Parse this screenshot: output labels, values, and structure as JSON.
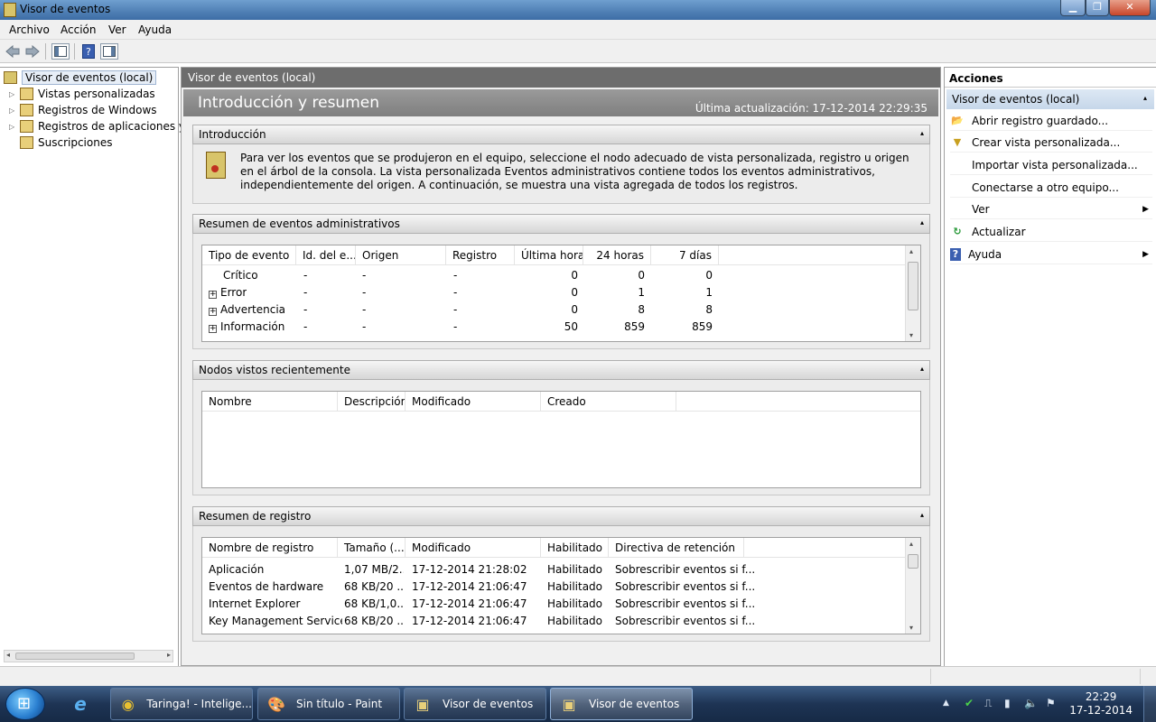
{
  "window": {
    "title": "Visor de eventos",
    "controls": {
      "minimize": "▁",
      "maximize": "❐",
      "close": "✕"
    }
  },
  "menu": [
    "Archivo",
    "Acción",
    "Ver",
    "Ayuda"
  ],
  "toolbar": {
    "back_icon": "back-arrow-icon",
    "forward_icon": "forward-arrow-icon",
    "show_hide_icon": "console-tree-icon",
    "help_icon": "help-icon",
    "actions_pane_icon": "action-pane-icon"
  },
  "tree": {
    "items": [
      {
        "label": "Visor de eventos (local)",
        "expander": "",
        "selected": true
      },
      {
        "label": "Vistas personalizadas",
        "expander": "▷"
      },
      {
        "label": "Registros de Windows",
        "expander": "▷"
      },
      {
        "label": "Registros de aplicaciones y s",
        "expander": "▷"
      },
      {
        "label": "Suscripciones",
        "expander": ""
      }
    ],
    "scroll_left": "◂",
    "scroll_right": "▸"
  },
  "center": {
    "header": "Visor de eventos (local)",
    "intro_title": "Introducción y resumen",
    "last_update": "Última actualización: 17-12-2014 22:29:35",
    "collapse_glyph": "▴",
    "sections": {
      "intro": {
        "title": "Introducción",
        "text": "Para ver los eventos que se produjeron en el equipo, seleccione el nodo adecuado de vista personalizada, registro u origen en el árbol de la consola. La vista personalizada Eventos administrativos contiene todos los eventos administrativos, independientemente del origen. A continuación, se muestra una vista agregada de todos los registros."
      },
      "admin_summary": {
        "title": "Resumen de eventos administrativos",
        "columns": [
          "Tipo de evento",
          "Id. del e...",
          "Origen",
          "Registro",
          "Última hora",
          "24 horas",
          "7 días"
        ],
        "rows": [
          {
            "expand": "",
            "type": "Crítico",
            "id": "-",
            "source": "-",
            "log": "-",
            "last_hour": "0",
            "h24": "0",
            "d7": "0"
          },
          {
            "expand": "+",
            "type": "Error",
            "id": "-",
            "source": "-",
            "log": "-",
            "last_hour": "0",
            "h24": "1",
            "d7": "1"
          },
          {
            "expand": "+",
            "type": "Advertencia",
            "id": "-",
            "source": "-",
            "log": "-",
            "last_hour": "0",
            "h24": "8",
            "d7": "8"
          },
          {
            "expand": "+",
            "type": "Información",
            "id": "-",
            "source": "-",
            "log": "-",
            "last_hour": "50",
            "h24": "859",
            "d7": "859"
          }
        ]
      },
      "recent_nodes": {
        "title": "Nodos vistos recientemente",
        "columns": [
          "Nombre",
          "Descripción",
          "Modificado",
          "Creado"
        ]
      },
      "log_summary": {
        "title": "Resumen de registro",
        "columns": [
          "Nombre de registro",
          "Tamaño (...",
          "Modificado",
          "Habilitado",
          "Directiva de retención"
        ],
        "rows": [
          {
            "name": "Aplicación",
            "size": "1,07 MB/2...",
            "modified": "17-12-2014 21:28:02",
            "enabled": "Habilitado",
            "policy": "Sobrescribir eventos si f..."
          },
          {
            "name": "Eventos de hardware",
            "size": "68 KB/20 ...",
            "modified": "17-12-2014 21:06:47",
            "enabled": "Habilitado",
            "policy": "Sobrescribir eventos si f..."
          },
          {
            "name": "Internet Explorer",
            "size": "68 KB/1,0...",
            "modified": "17-12-2014 21:06:47",
            "enabled": "Habilitado",
            "policy": "Sobrescribir eventos si f..."
          },
          {
            "name": "Key Management Service",
            "size": "68 KB/20 ...",
            "modified": "17-12-2014 21:06:47",
            "enabled": "Habilitado",
            "policy": "Sobrescribir eventos si f..."
          }
        ]
      }
    },
    "scroll_up": "▴",
    "scroll_down": "▾"
  },
  "actions": {
    "title": "Acciones",
    "group": "Visor de eventos (local)",
    "items": [
      {
        "label": "Abrir registro guardado...",
        "icon": "open-folder-icon",
        "glyph": "📂",
        "submenu": ""
      },
      {
        "label": "Crear vista personalizada...",
        "icon": "filter-icon",
        "glyph": "▼",
        "submenu": ""
      },
      {
        "label": "Importar vista personalizada...",
        "icon": "",
        "glyph": "",
        "submenu": ""
      },
      {
        "label": "Conectarse a otro equipo...",
        "icon": "",
        "glyph": "",
        "submenu": ""
      },
      {
        "label": "Ver",
        "icon": "",
        "glyph": "",
        "submenu": "▶"
      },
      {
        "label": "Actualizar",
        "icon": "refresh-icon",
        "glyph": "↻",
        "submenu": ""
      },
      {
        "label": "Ayuda",
        "icon": "help-icon",
        "glyph": "?",
        "submenu": "▶"
      }
    ]
  },
  "taskbar": {
    "pinned": [
      {
        "name": "internet-explorer-icon",
        "glyph": "e"
      }
    ],
    "tasks": [
      {
        "label": "Taringa! - Intelige...",
        "icon": "chrome-icon",
        "glyph": "◉",
        "active": false
      },
      {
        "label": "Sin título - Paint",
        "icon": "paint-icon",
        "glyph": "🎨",
        "active": false
      },
      {
        "label": "Visor de eventos",
        "icon": "event-viewer-icon",
        "glyph": "▣",
        "active": false
      },
      {
        "label": "Visor de eventos",
        "icon": "event-viewer-icon",
        "glyph": "▣",
        "active": true
      }
    ],
    "tray": [
      {
        "name": "notification-icon",
        "glyph": "▲"
      },
      {
        "name": "security-icon",
        "glyph": "✔"
      },
      {
        "name": "usb-icon",
        "glyph": "⎍"
      },
      {
        "name": "signal-icon",
        "glyph": "▮"
      },
      {
        "name": "volume-icon",
        "glyph": "🔈"
      },
      {
        "name": "flag-icon",
        "glyph": "⚑"
      }
    ],
    "time": "22:29",
    "date": "17-12-2014"
  }
}
